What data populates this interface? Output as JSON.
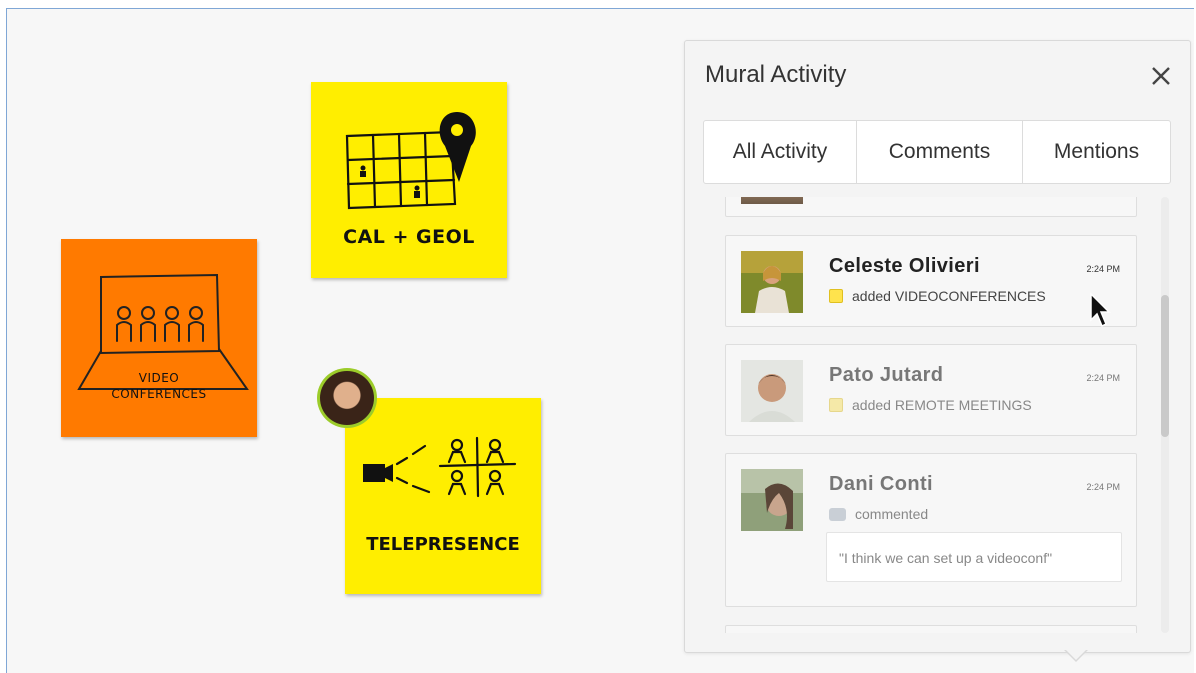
{
  "board": {
    "notes": [
      {
        "label": "CAL + GEOL",
        "color": "#ffee00"
      },
      {
        "label_lines": [
          "VIDEO",
          "CONFERENCES"
        ],
        "color": "#ff7a00"
      },
      {
        "label": "TELEPRESENCE",
        "color": "#ffee00"
      }
    ],
    "collaborator_ring_color": "#9ccc2a"
  },
  "panel": {
    "title": "Mural Activity",
    "close_icon": "close-icon",
    "tabs": [
      {
        "label": "All Activity",
        "selected": true
      },
      {
        "label": "Comments",
        "selected": false
      },
      {
        "label": "Mentions",
        "selected": false
      }
    ],
    "items": [
      {
        "name": "Celeste Olivieri",
        "time": "2:24 PM",
        "action": "added VIDEOCONFERENCES",
        "icon": "sticky-note-icon",
        "active": true
      },
      {
        "name": "Pato Jutard",
        "time": "2:24 PM",
        "action": "added REMOTE MEETINGS",
        "icon": "sticky-note-icon",
        "active": false
      },
      {
        "name": "Dani Conti",
        "time": "2:24 PM",
        "action": "commented",
        "icon": "comment-icon",
        "comment": "\"I think we can set up a videoconf\"",
        "active": false
      }
    ]
  }
}
